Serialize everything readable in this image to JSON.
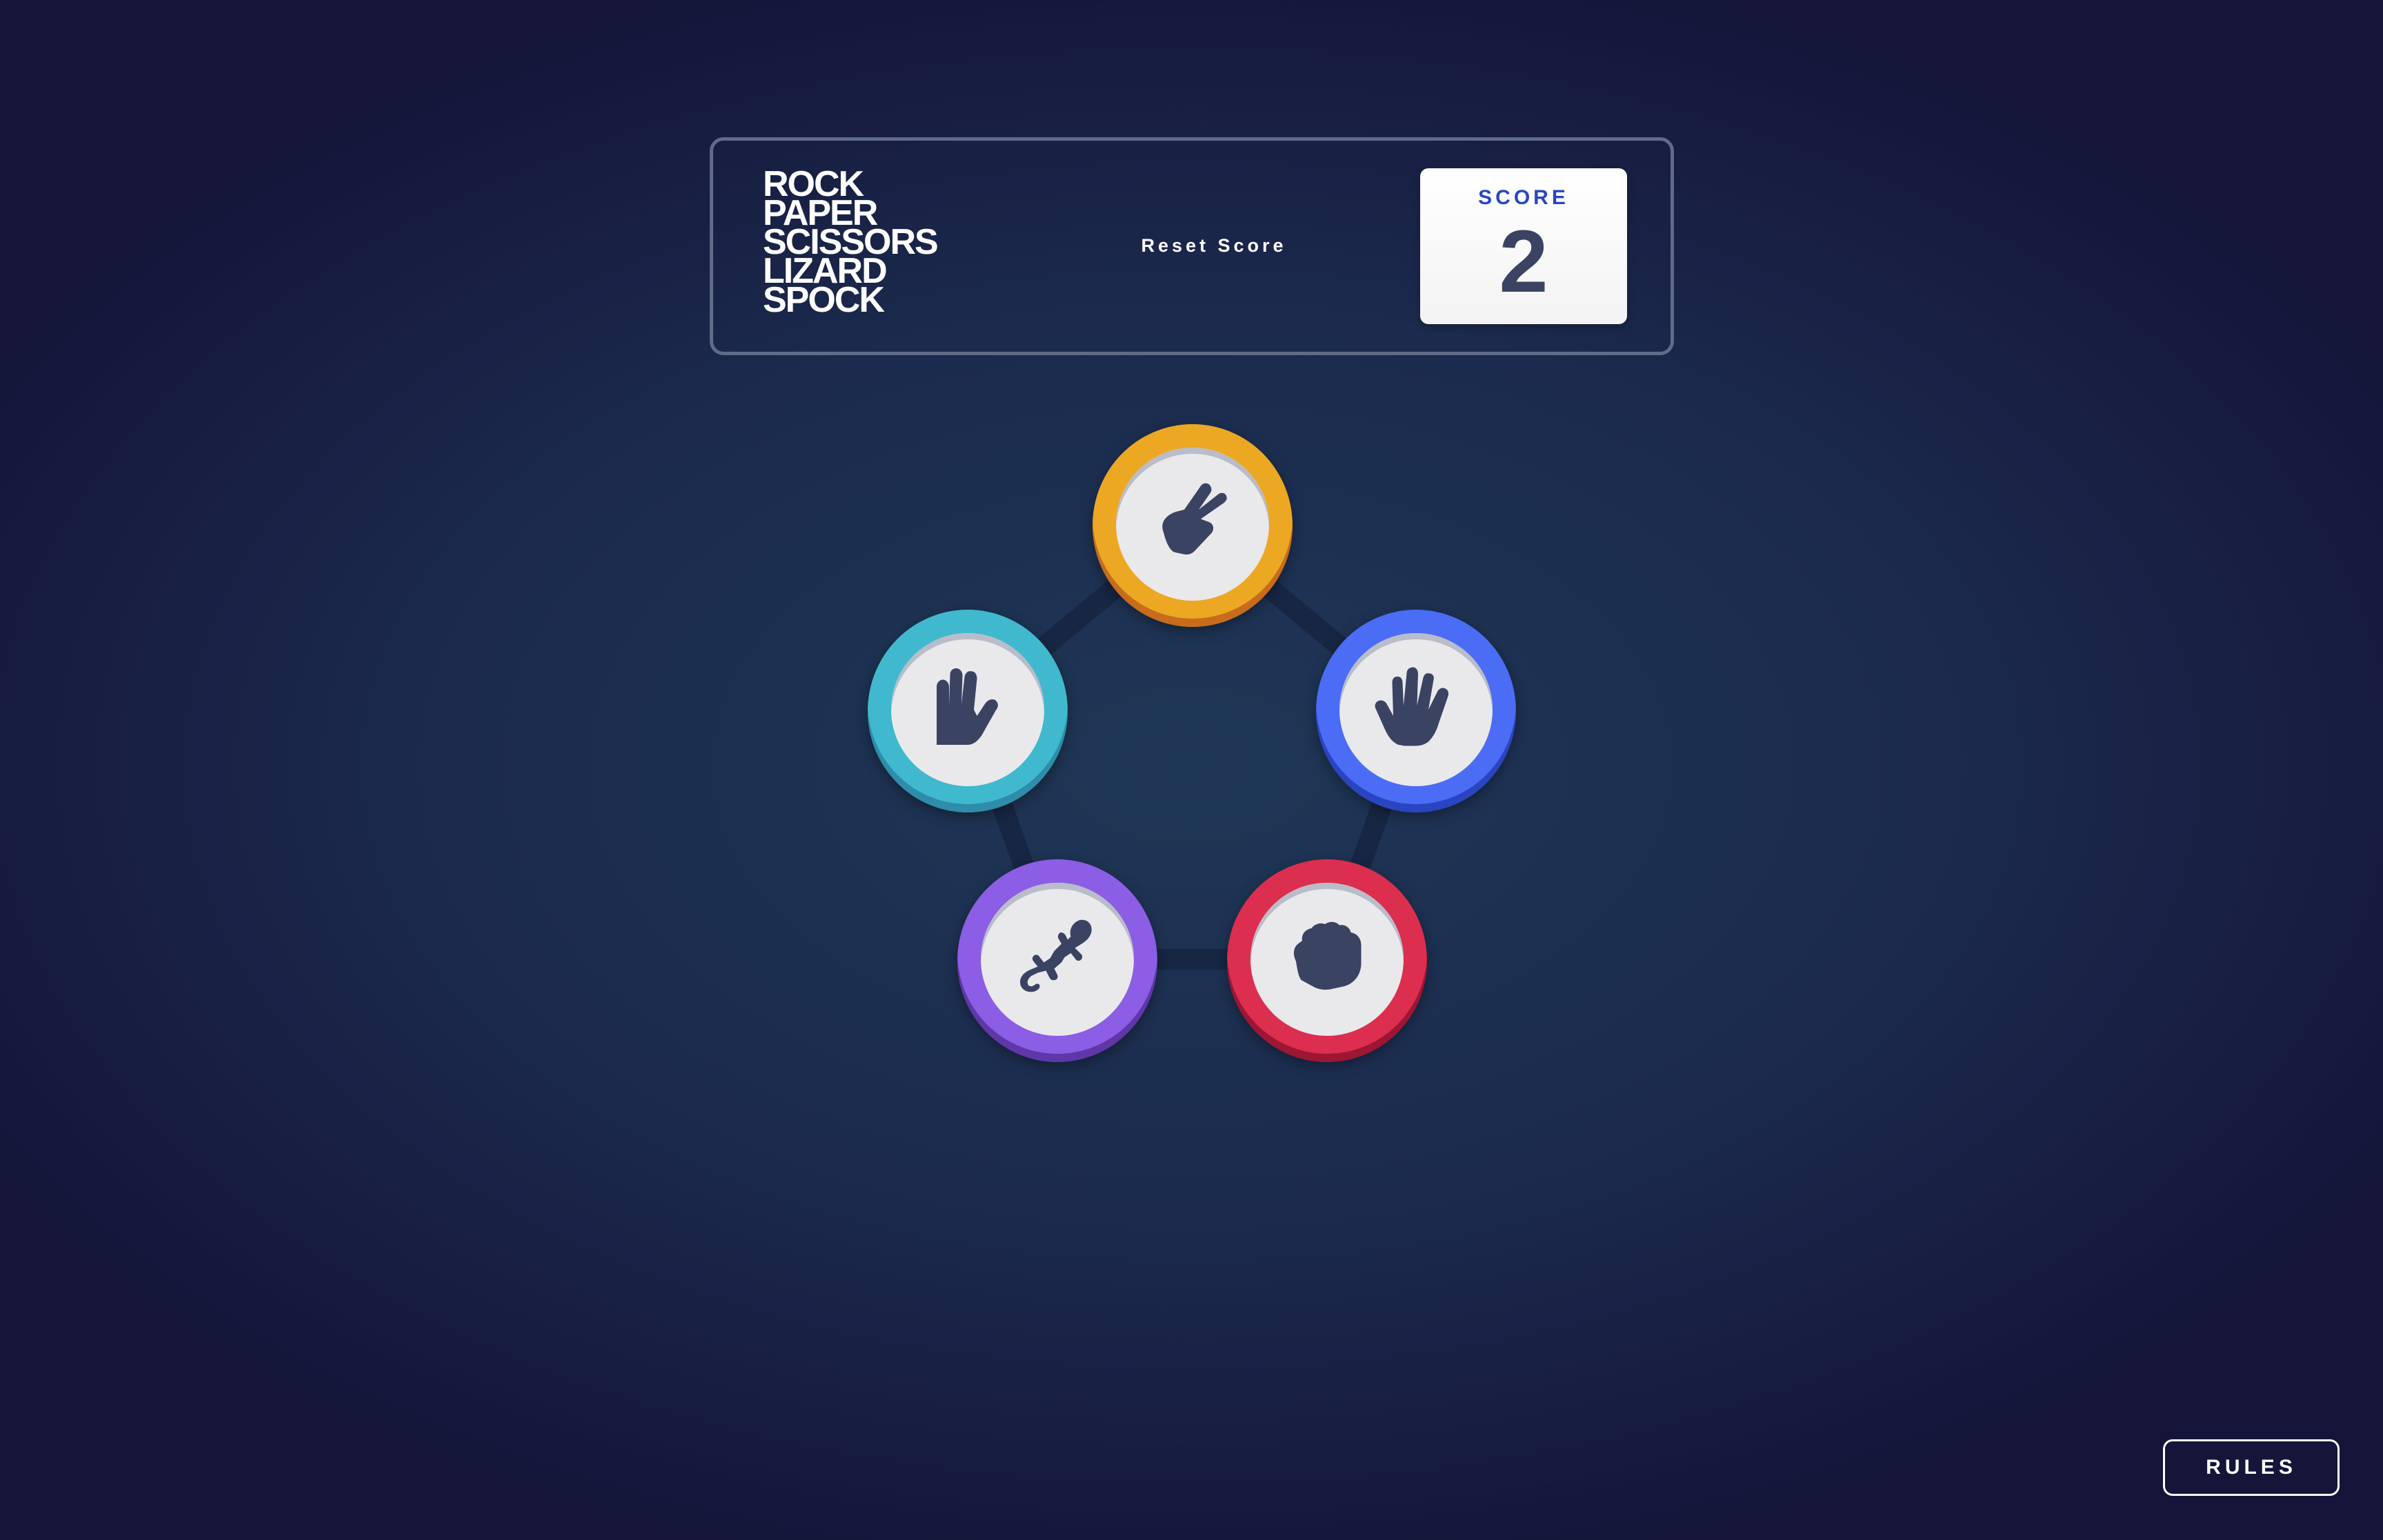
{
  "header": {
    "title_lines": [
      "ROCK",
      "PAPER",
      "SCISSORS",
      "LIZARD",
      "SPOCK"
    ],
    "reset_label": "Reset Score",
    "score_label": "SCORE",
    "score_value": "2"
  },
  "tokens": [
    {
      "choice": "scissors",
      "icon": "scissors-hand-icon",
      "ring_color": "#eca823"
    },
    {
      "choice": "paper",
      "icon": "paper-hand-icon",
      "ring_color": "#4b6cf5"
    },
    {
      "choice": "rock",
      "icon": "rock-fist-icon",
      "ring_color": "#dc2e4e"
    },
    {
      "choice": "lizard",
      "icon": "lizard-icon",
      "ring_color": "#8c5de5"
    },
    {
      "choice": "spock",
      "icon": "spock-hand-icon",
      "ring_color": "#40b9ce"
    }
  ],
  "rules_label": "RULES",
  "colors": {
    "background": "#1f3756",
    "header_border": "#5f6b88",
    "score_label": "#2a46c0",
    "score_value": "#3b4363",
    "icon_fill": "#3b4363"
  }
}
